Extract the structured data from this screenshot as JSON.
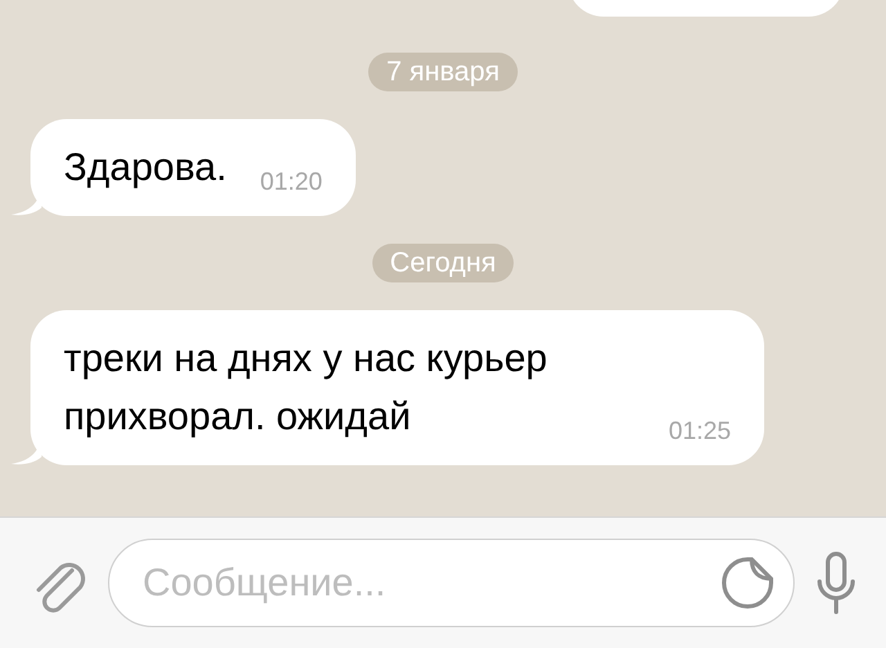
{
  "messages": [
    {
      "kind": "date",
      "text": "7 января"
    },
    {
      "kind": "incoming",
      "text": "Здарова.",
      "time": "01:20"
    },
    {
      "kind": "date",
      "text": "Сегодня"
    },
    {
      "kind": "incoming",
      "text": "треки на днях у нас курьер прихворал. ожидай",
      "time": "01:25"
    }
  ],
  "composer": {
    "placeholder": "Сообщение..."
  }
}
